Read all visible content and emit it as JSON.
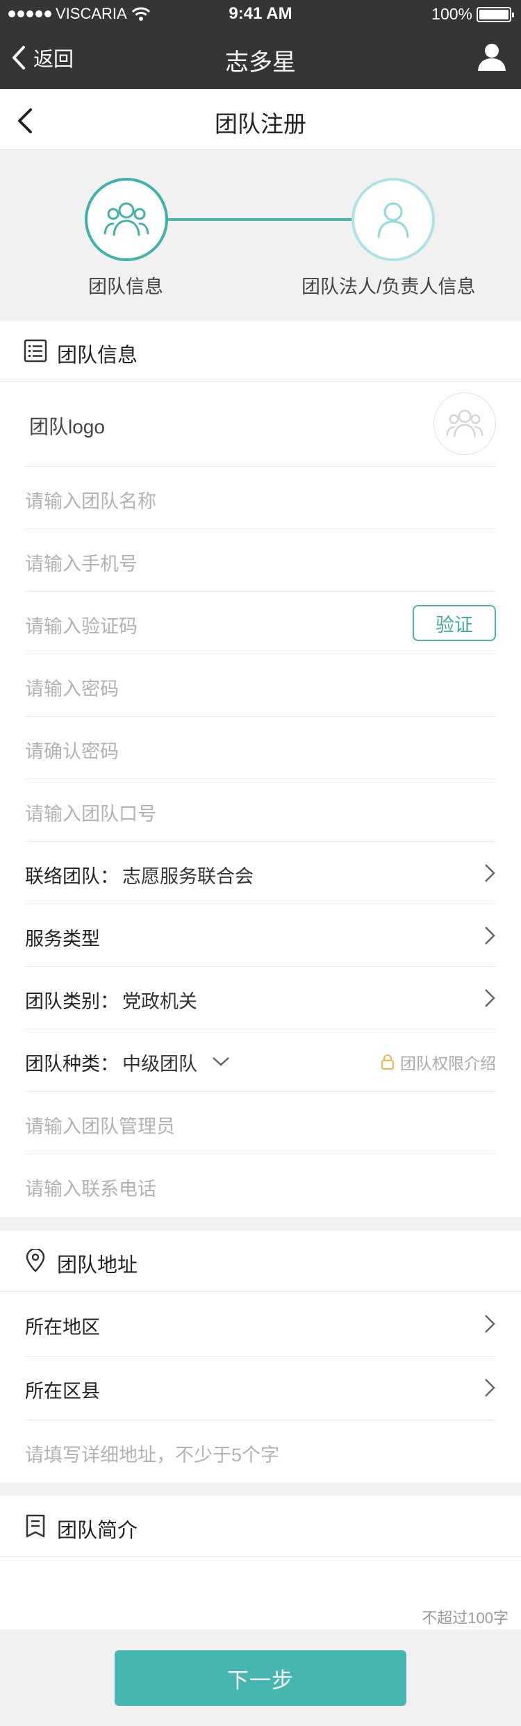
{
  "status_bar": {
    "carrier": "VISCARIA",
    "time": "9:41 AM",
    "battery": "100%"
  },
  "navbar": {
    "back_label": "返回",
    "title": "志多星"
  },
  "subheader": {
    "title": "团队注册"
  },
  "steps": [
    {
      "label": "团队信息",
      "state": "active"
    },
    {
      "label": "团队法人/负责人信息",
      "state": "inactive"
    }
  ],
  "team_info": {
    "title": "团队信息",
    "logo_label": "团队logo",
    "name_placeholder": "请输入团队名称",
    "phone_placeholder": "请输入手机号",
    "code_placeholder": "请输入验证码",
    "verify_label": "验证",
    "password_placeholder": "请输入密码",
    "confirm_password_placeholder": "请确认密码",
    "slogan_placeholder": "请输入团队口号",
    "liaison_label": "联络团队：",
    "liaison_value": "志愿服务联合会",
    "service_type_label": "服务类型",
    "category_label": "团队类别：",
    "category_value": "党政机关",
    "kind_label": "团队种类：",
    "kind_value": "中级团队",
    "permission_label": "团队权限介绍",
    "admin_placeholder": "请输入团队管理员",
    "contact_placeholder": "请输入联系电话"
  },
  "address": {
    "title": "团队地址",
    "region_label": "所在地区",
    "county_label": "所在区县",
    "detail_placeholder": "请填写详细地址，不少于5个字"
  },
  "intro": {
    "title": "团队简介",
    "limit": "不超过100字"
  },
  "footer": {
    "next_label": "下一步"
  },
  "colors": {
    "accent": "#45b6b0",
    "accent_light": "#a9e3e6",
    "navbar": "#353535",
    "permission": "#f0b64a"
  }
}
